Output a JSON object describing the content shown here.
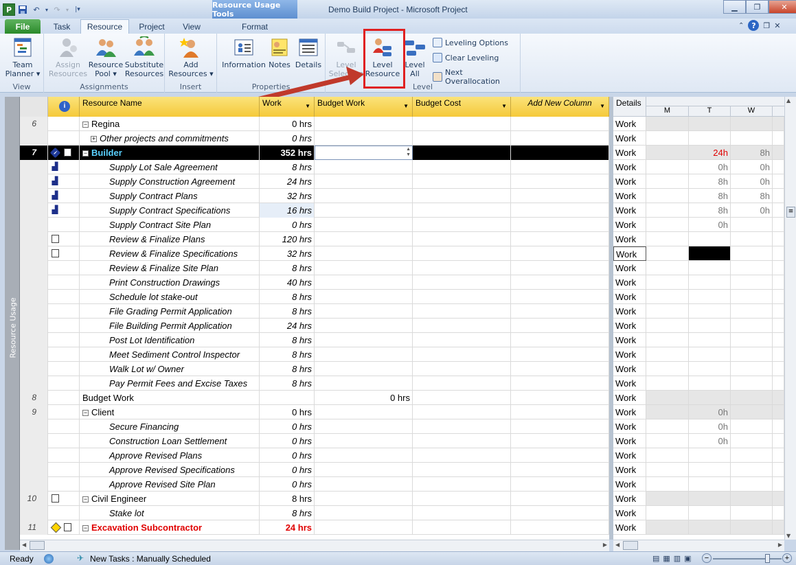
{
  "window": {
    "title": "Demo Build Project  -  Microsoft Project",
    "context_tab_group": "Resource Usage Tools",
    "app_icon": "P"
  },
  "tabs": [
    {
      "label": "File"
    },
    {
      "label": "Task"
    },
    {
      "label": "Resource"
    },
    {
      "label": "Project"
    },
    {
      "label": "View"
    },
    {
      "label": "Format"
    }
  ],
  "ribbon": {
    "view": {
      "label": "View",
      "team_planner": "Team\nPlanner ▾"
    },
    "assignments": {
      "label": "Assignments",
      "assign": "Assign\nResources",
      "pool": "Resource\nPool ▾",
      "substitute": "Substitute\nResources"
    },
    "insert": {
      "label": "Insert",
      "add": "Add\nResources ▾"
    },
    "properties": {
      "label": "Properties",
      "information": "Information",
      "notes": "Notes",
      "details": "Details"
    },
    "level": {
      "label": "Level",
      "level_selection": "Level\nSelection",
      "level_resource": "Level\nResource",
      "level_all": "Level\nAll",
      "options": "Leveling Options",
      "clear": "Clear Leveling",
      "next": "Next Overallocation"
    }
  },
  "side_label": "Resource Usage",
  "columns": [
    "Resource Name",
    "Work",
    "Budget Work",
    "Budget Cost",
    "Add New Column"
  ],
  "timescale": {
    "details_header": "Details",
    "days": [
      "M",
      "T",
      "W"
    ]
  },
  "rows": [
    {
      "id": "6",
      "name": "Regina",
      "work": "0 hrs",
      "level": 0,
      "exp": "−",
      "det": "Work",
      "t": "",
      "w": ""
    },
    {
      "id": "",
      "name": "Other projects and commitments",
      "work": "0 hrs",
      "level": 1,
      "exp": "+",
      "det": "Work",
      "t": "",
      "w": ""
    },
    {
      "id": "7",
      "name": "Builder",
      "work": "352 hrs",
      "level": 0,
      "exp": "−",
      "sel": true,
      "det": "Work",
      "t": "24h",
      "w": "8h"
    },
    {
      "id": "",
      "name": "Supply Lot Sale Agreement",
      "work": "8 hrs",
      "level": 2,
      "det": "Work",
      "t": "0h",
      "w": "0h"
    },
    {
      "id": "",
      "name": "Supply Construction Agreement",
      "work": "24 hrs",
      "level": 2,
      "det": "Work",
      "t": "8h",
      "w": "0h"
    },
    {
      "id": "",
      "name": "Supply Contract Plans",
      "work": "32 hrs",
      "level": 2,
      "det": "Work",
      "t": "8h",
      "w": "8h"
    },
    {
      "id": "",
      "name": "Supply Contract Specifications",
      "work": "16 hrs",
      "level": 2,
      "det": "Work",
      "t": "8h",
      "w": "0h"
    },
    {
      "id": "",
      "name": "Supply Contract Site Plan",
      "work": "0 hrs",
      "level": 2,
      "det": "Work",
      "t": "0h",
      "w": ""
    },
    {
      "id": "",
      "name": "Review & Finalize Plans",
      "work": "120 hrs",
      "level": 2,
      "det": "Work",
      "t": "",
      "w": ""
    },
    {
      "id": "",
      "name": "Review & Finalize Specifications",
      "work": "32 hrs",
      "level": 2,
      "det": "Work",
      "t": "",
      "w": ""
    },
    {
      "id": "",
      "name": "Review & Finalize Site Plan",
      "work": "8 hrs",
      "level": 2,
      "det": "Work",
      "t": "",
      "w": ""
    },
    {
      "id": "",
      "name": "Print Construction Drawings",
      "work": "40 hrs",
      "level": 2,
      "det": "Work",
      "t": "",
      "w": ""
    },
    {
      "id": "",
      "name": "Schedule lot stake-out",
      "work": "8 hrs",
      "level": 2,
      "det": "Work",
      "t": "",
      "w": ""
    },
    {
      "id": "",
      "name": "File Grading Permit Application",
      "work": "8 hrs",
      "level": 2,
      "det": "Work",
      "t": "",
      "w": ""
    },
    {
      "id": "",
      "name": "File Building Permit Application",
      "work": "24 hrs",
      "level": 2,
      "det": "Work",
      "t": "",
      "w": ""
    },
    {
      "id": "",
      "name": "Post Lot Identification",
      "work": "8 hrs",
      "level": 2,
      "det": "Work",
      "t": "",
      "w": ""
    },
    {
      "id": "",
      "name": "Meet Sediment Control Inspector",
      "work": "8 hrs",
      "level": 2,
      "det": "Work",
      "t": "",
      "w": ""
    },
    {
      "id": "",
      "name": "Walk Lot w/ Owner",
      "work": "8 hrs",
      "level": 2,
      "det": "Work",
      "t": "",
      "w": ""
    },
    {
      "id": "",
      "name": "Pay Permit Fees and Excise Taxes",
      "work": "8 hrs",
      "level": 2,
      "det": "Work",
      "t": "",
      "w": ""
    },
    {
      "id": "8",
      "name": "Budget Work",
      "work": "",
      "bw": "0 hrs",
      "level": 0,
      "det": "Work",
      "t": "",
      "w": ""
    },
    {
      "id": "9",
      "name": "Client",
      "work": "0 hrs",
      "level": 0,
      "exp": "−",
      "det": "Work",
      "t": "0h",
      "w": ""
    },
    {
      "id": "",
      "name": "Secure Financing",
      "work": "0 hrs",
      "level": 2,
      "det": "Work",
      "t": "0h",
      "w": ""
    },
    {
      "id": "",
      "name": "Construction Loan Settlement",
      "work": "0 hrs",
      "level": 2,
      "det": "Work",
      "t": "0h",
      "w": ""
    },
    {
      "id": "",
      "name": "Approve Revised Plans",
      "work": "0 hrs",
      "level": 2,
      "det": "Work",
      "t": "",
      "w": ""
    },
    {
      "id": "",
      "name": "Approve Revised Specifications",
      "work": "0 hrs",
      "level": 2,
      "det": "Work",
      "t": "",
      "w": ""
    },
    {
      "id": "",
      "name": "Approve Revised Site Plan",
      "work": "0 hrs",
      "level": 2,
      "det": "Work",
      "t": "",
      "w": ""
    },
    {
      "id": "10",
      "name": "Civil Engineer",
      "work": "8 hrs",
      "level": 0,
      "exp": "−",
      "det": "Work",
      "t": "",
      "w": ""
    },
    {
      "id": "",
      "name": "Stake lot",
      "work": "8 hrs",
      "level": 2,
      "det": "Work",
      "t": "",
      "w": ""
    },
    {
      "id": "11",
      "name": "Excavation Subcontractor",
      "work": "24 hrs",
      "level": 0,
      "exp": "−",
      "over": true,
      "det": "Work",
      "t": "",
      "w": ""
    }
  ],
  "status": {
    "ready": "Ready",
    "new_tasks": "New Tasks : Manually Scheduled"
  }
}
